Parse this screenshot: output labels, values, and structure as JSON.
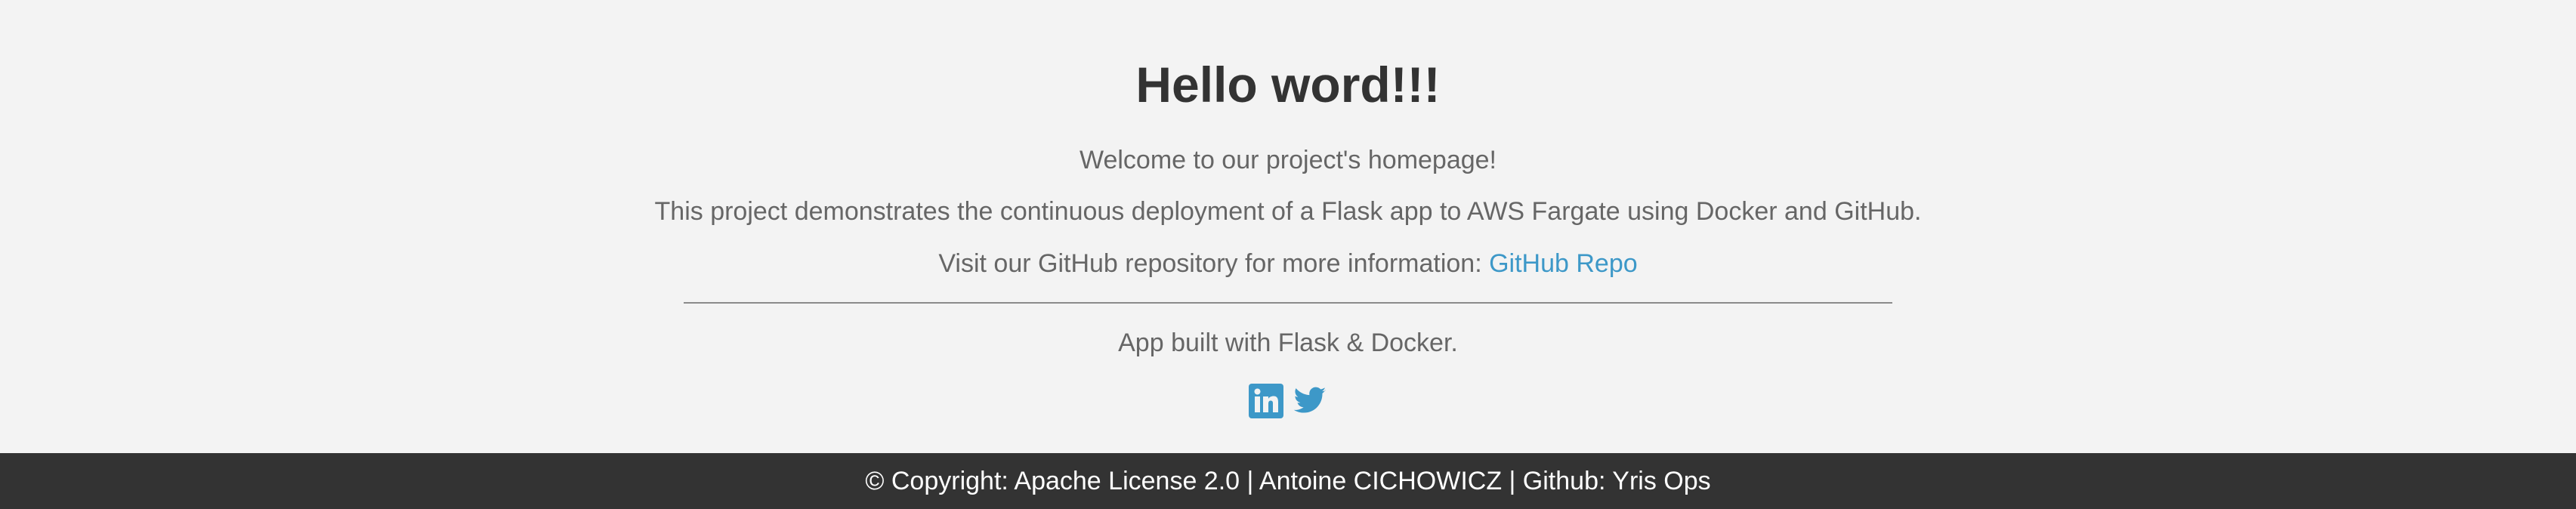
{
  "header": {
    "title": "Hello word!!!"
  },
  "main": {
    "welcome": "Welcome to our project's homepage!",
    "description": "This project demonstrates the continuous deployment of a Flask app to AWS Fargate using Docker and GitHub.",
    "visit_prefix": "Visit our GitHub repository for more information: ",
    "repo_link_label": "GitHub Repo",
    "built_with": "App built with Flask & Docker."
  },
  "social": {
    "icons": [
      "linkedin-icon",
      "twitter-icon"
    ],
    "color": "#3d98c8"
  },
  "footer": {
    "text": "© Copyright: Apache License 2.0 | Antoine CICHOWICZ | Github: Yris Ops"
  },
  "colors": {
    "background": "#f3f3f3",
    "footer_background": "#333333",
    "heading": "#333333",
    "body_text": "#666666",
    "link": "#3d98c8"
  }
}
